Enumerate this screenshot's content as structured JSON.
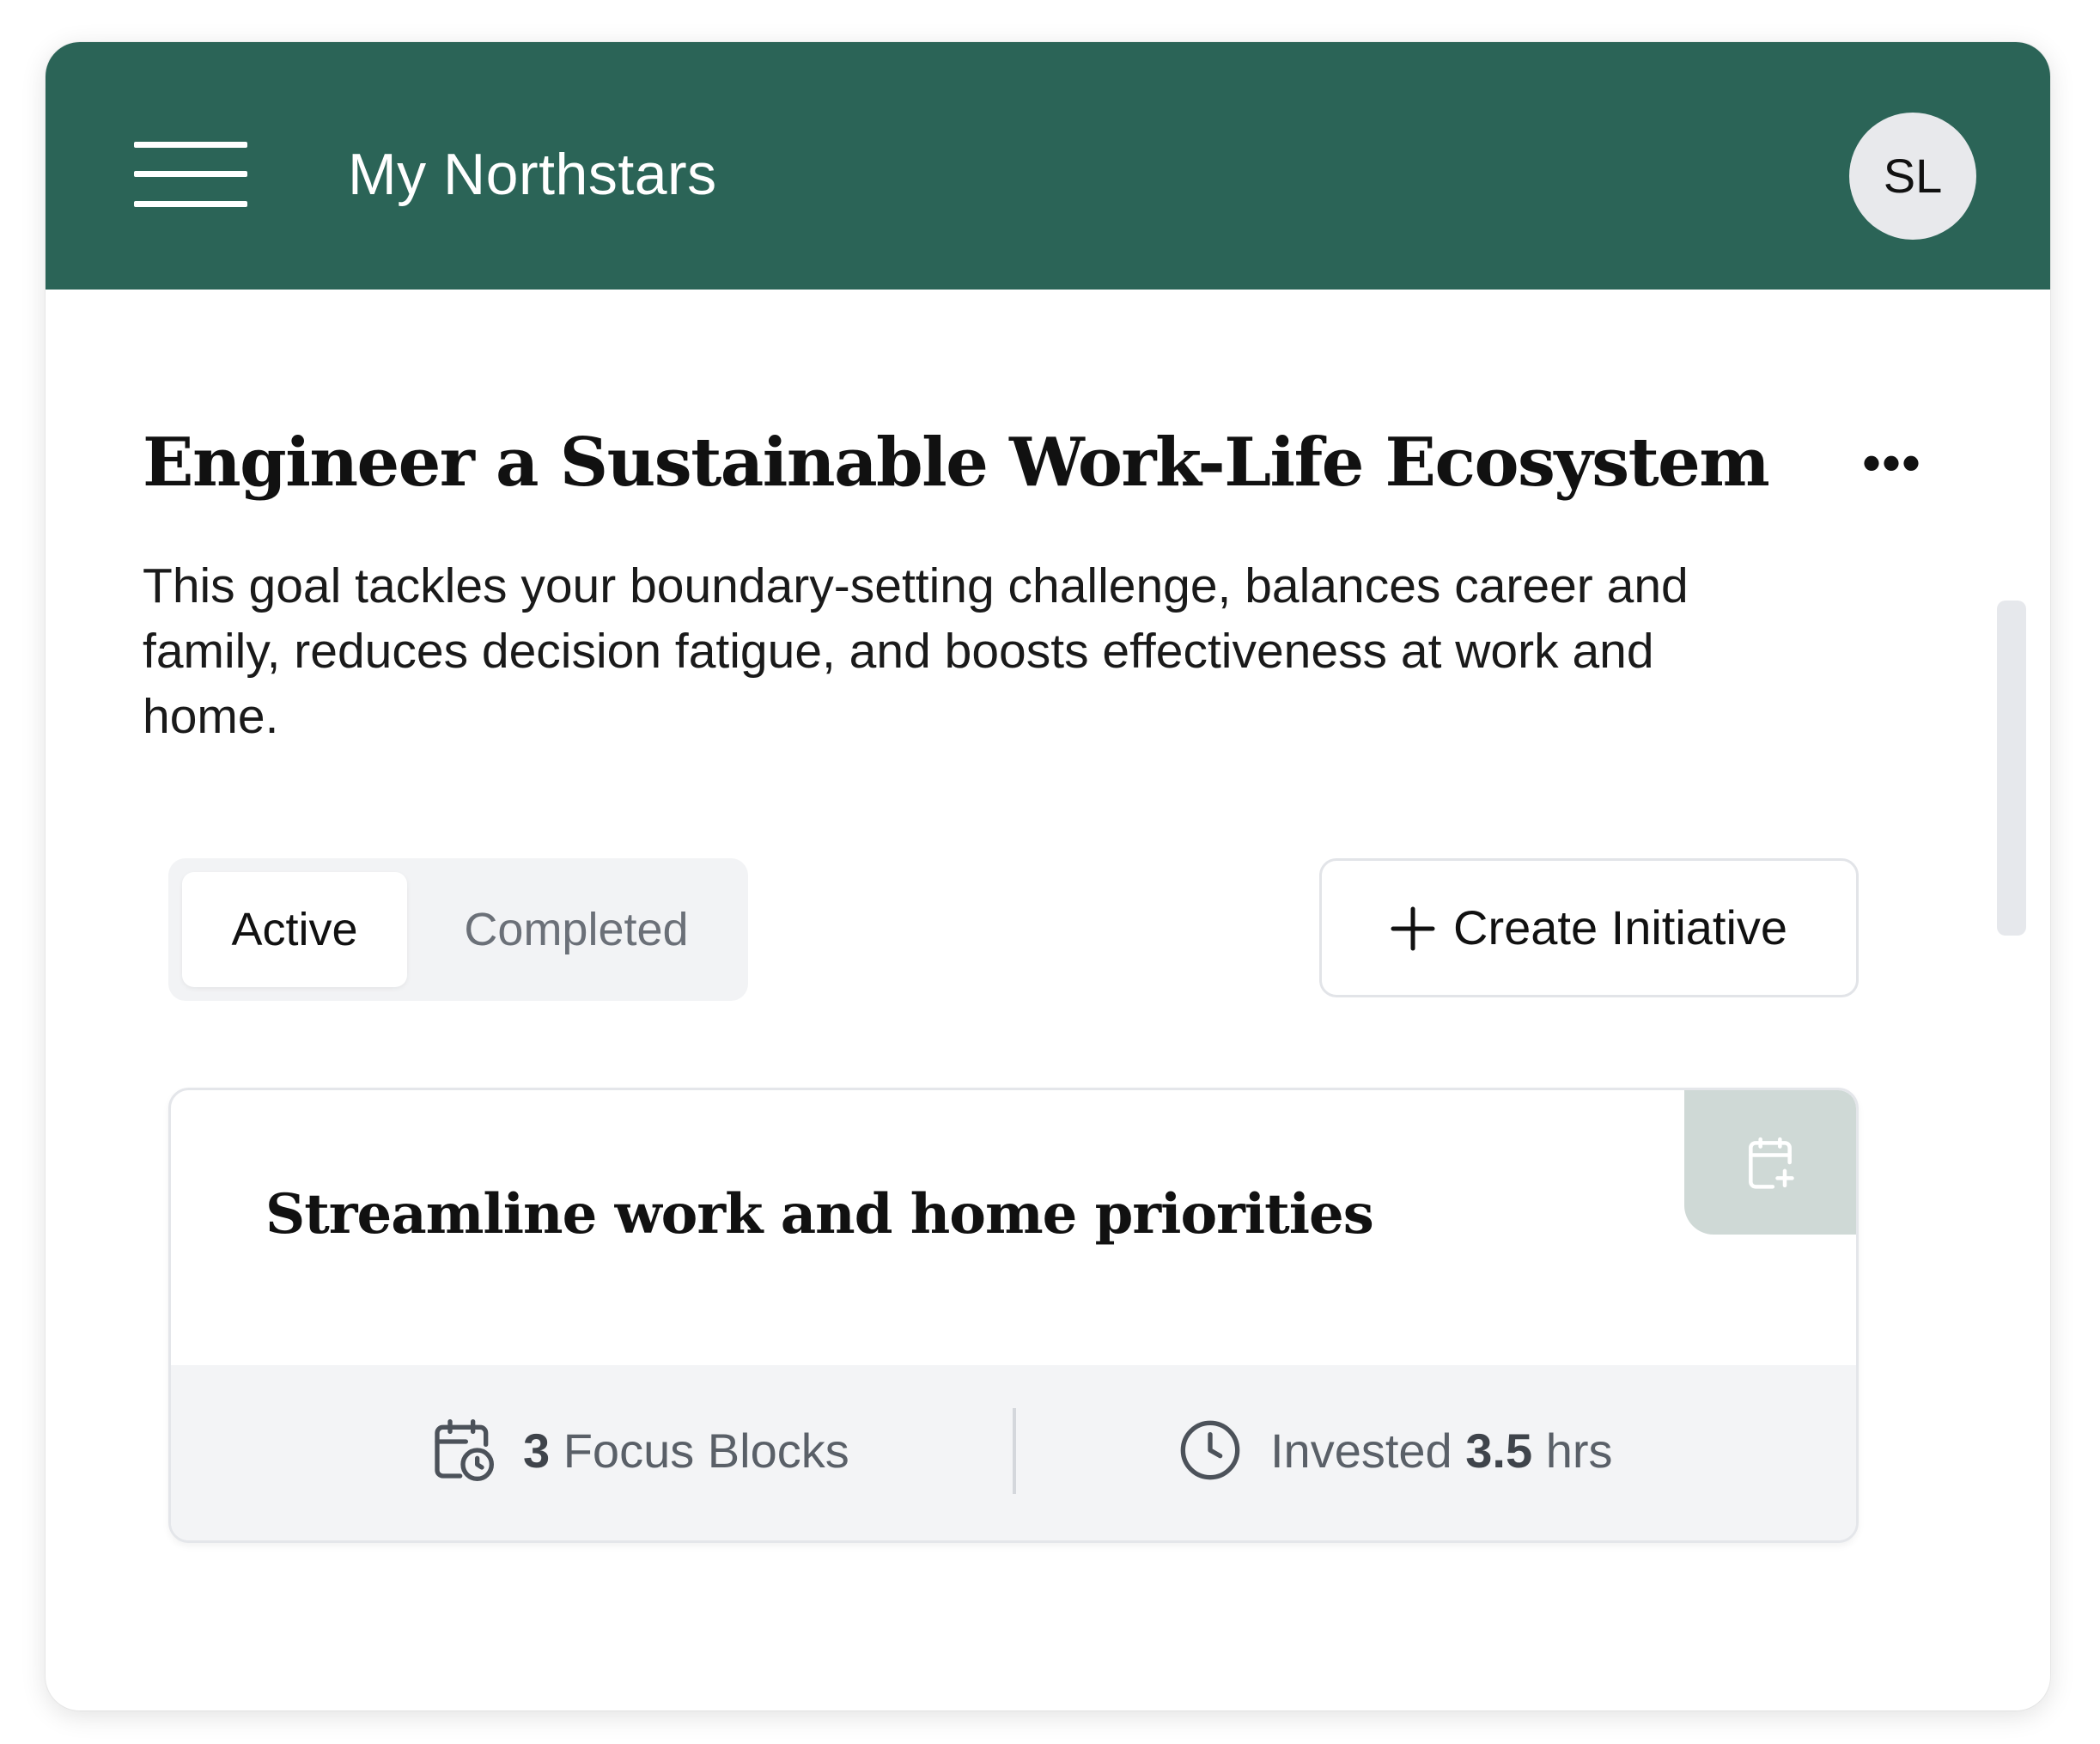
{
  "header": {
    "title": "My Northstars",
    "avatar_initials": "SL",
    "background_color": "#2b6457"
  },
  "goal": {
    "title": "Engineer a Sustainable Work-Life Ecosystem",
    "more_label": "•••",
    "description": "This goal tackles your boundary-setting challenge, balances career and family, reduces decision fatigue, and boosts effectiveness at work and home."
  },
  "tabs": {
    "items": [
      {
        "label": "Active",
        "selected": true
      },
      {
        "label": "Completed",
        "selected": false
      }
    ]
  },
  "create_button": {
    "label": "Create Initiative",
    "icon": "plus-icon"
  },
  "initiatives": [
    {
      "title": "Streamline work and home priorities",
      "schedule_icon": "calendar-plus-icon",
      "focus_blocks": {
        "count": "3",
        "label": "Focus Blocks",
        "icon": "calendar-clock-icon"
      },
      "invested": {
        "prefix": "Invested",
        "value": "3.5",
        "unit": "hrs",
        "icon": "clock-icon"
      }
    }
  ]
}
